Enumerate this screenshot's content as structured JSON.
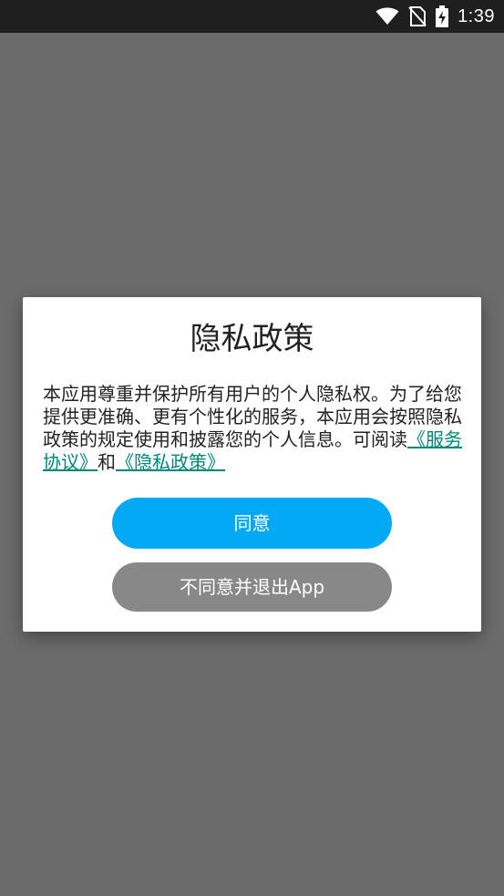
{
  "status_bar": {
    "time": "1:39",
    "icons": [
      "wifi-icon",
      "no-sim-icon",
      "battery-charging-icon"
    ]
  },
  "dialog": {
    "title": "隐私政策",
    "body_text": "本应用尊重并保护所有用户的个人隐私权。为了给您提供更准确、更有个性化的服务，本应用会按照隐私政策的规定使用和披露您的个人信息。可阅读",
    "link_service": "《服务协议》",
    "conjunction": "和",
    "link_privacy": "《隐私政策》",
    "agree_label": "同意",
    "disagree_label": "不同意并退出App"
  },
  "colors": {
    "overlay": "#6b6b6b",
    "status_bar": "#1f1f1f",
    "link": "#00897b",
    "agree_button": "#03a9f4",
    "disagree_button": "#888888"
  }
}
